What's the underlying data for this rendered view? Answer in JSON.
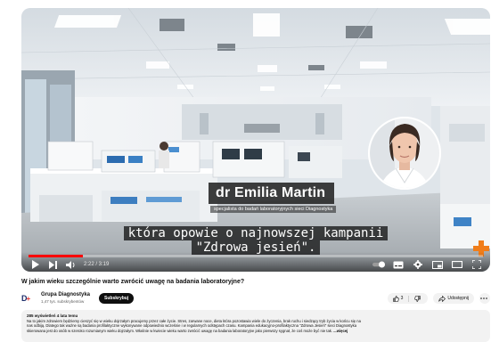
{
  "video": {
    "lower_third_name": "dr Emilia Martin",
    "lower_third_subtitle": "specjalista do badań laboratoryjnych sieci Diagnostyka",
    "subtitle_line1": "która opowie o najnowszej kampanii",
    "subtitle_line2": "\"Zdrowa jesień\".",
    "time": "2:22 / 3:19",
    "progress": 0.12
  },
  "title": "W jakim wieku szczególnie warto zwrócić uwagę na badania laboratoryjne?",
  "channel": {
    "name": "Grupa Diagnostyka",
    "subscribers": "1,47 tys. subskrybentów",
    "subscribe_label": "Subskrybuj",
    "logo_text": "D"
  },
  "actions": {
    "like_count": "3",
    "share_label": "Udostępnij"
  },
  "description": {
    "meta": "285 wyświetleń  4 lata temu",
    "line1": "Na to jakim zdrowiem będziemy cieszyć się w wieku dojrzałym pracujemy przez całe życie. Stres, zarwane noce, dieta która pozostawia wiele do życzenia, brak ruchu i siedzący tryb życia w końcu się na",
    "line2": "nas odbiją. Dlatego tak ważne są badania profilaktyczne wykonywane odpowiednio wcześnie i w regularnych odstępach czasu. Kampania edukacyjno-profilaktyczna \"Zdrowa Jesień\" sieci Diagnostyka",
    "line3": "skierowana jest do osób w szeroko rozumianym wieku dojrzałym. Właśnie w kwiecie wieku warto zwrócić uwagę na badania laboratoryjne jako pierwszy sygnał, że coś może być nie tak.",
    "more": "...więcej"
  },
  "colors": {
    "progress": "#ff0000",
    "accent_orange": "#f07d1a",
    "brand_navy": "#1d2e6b",
    "brand_red": "#e3312d"
  }
}
